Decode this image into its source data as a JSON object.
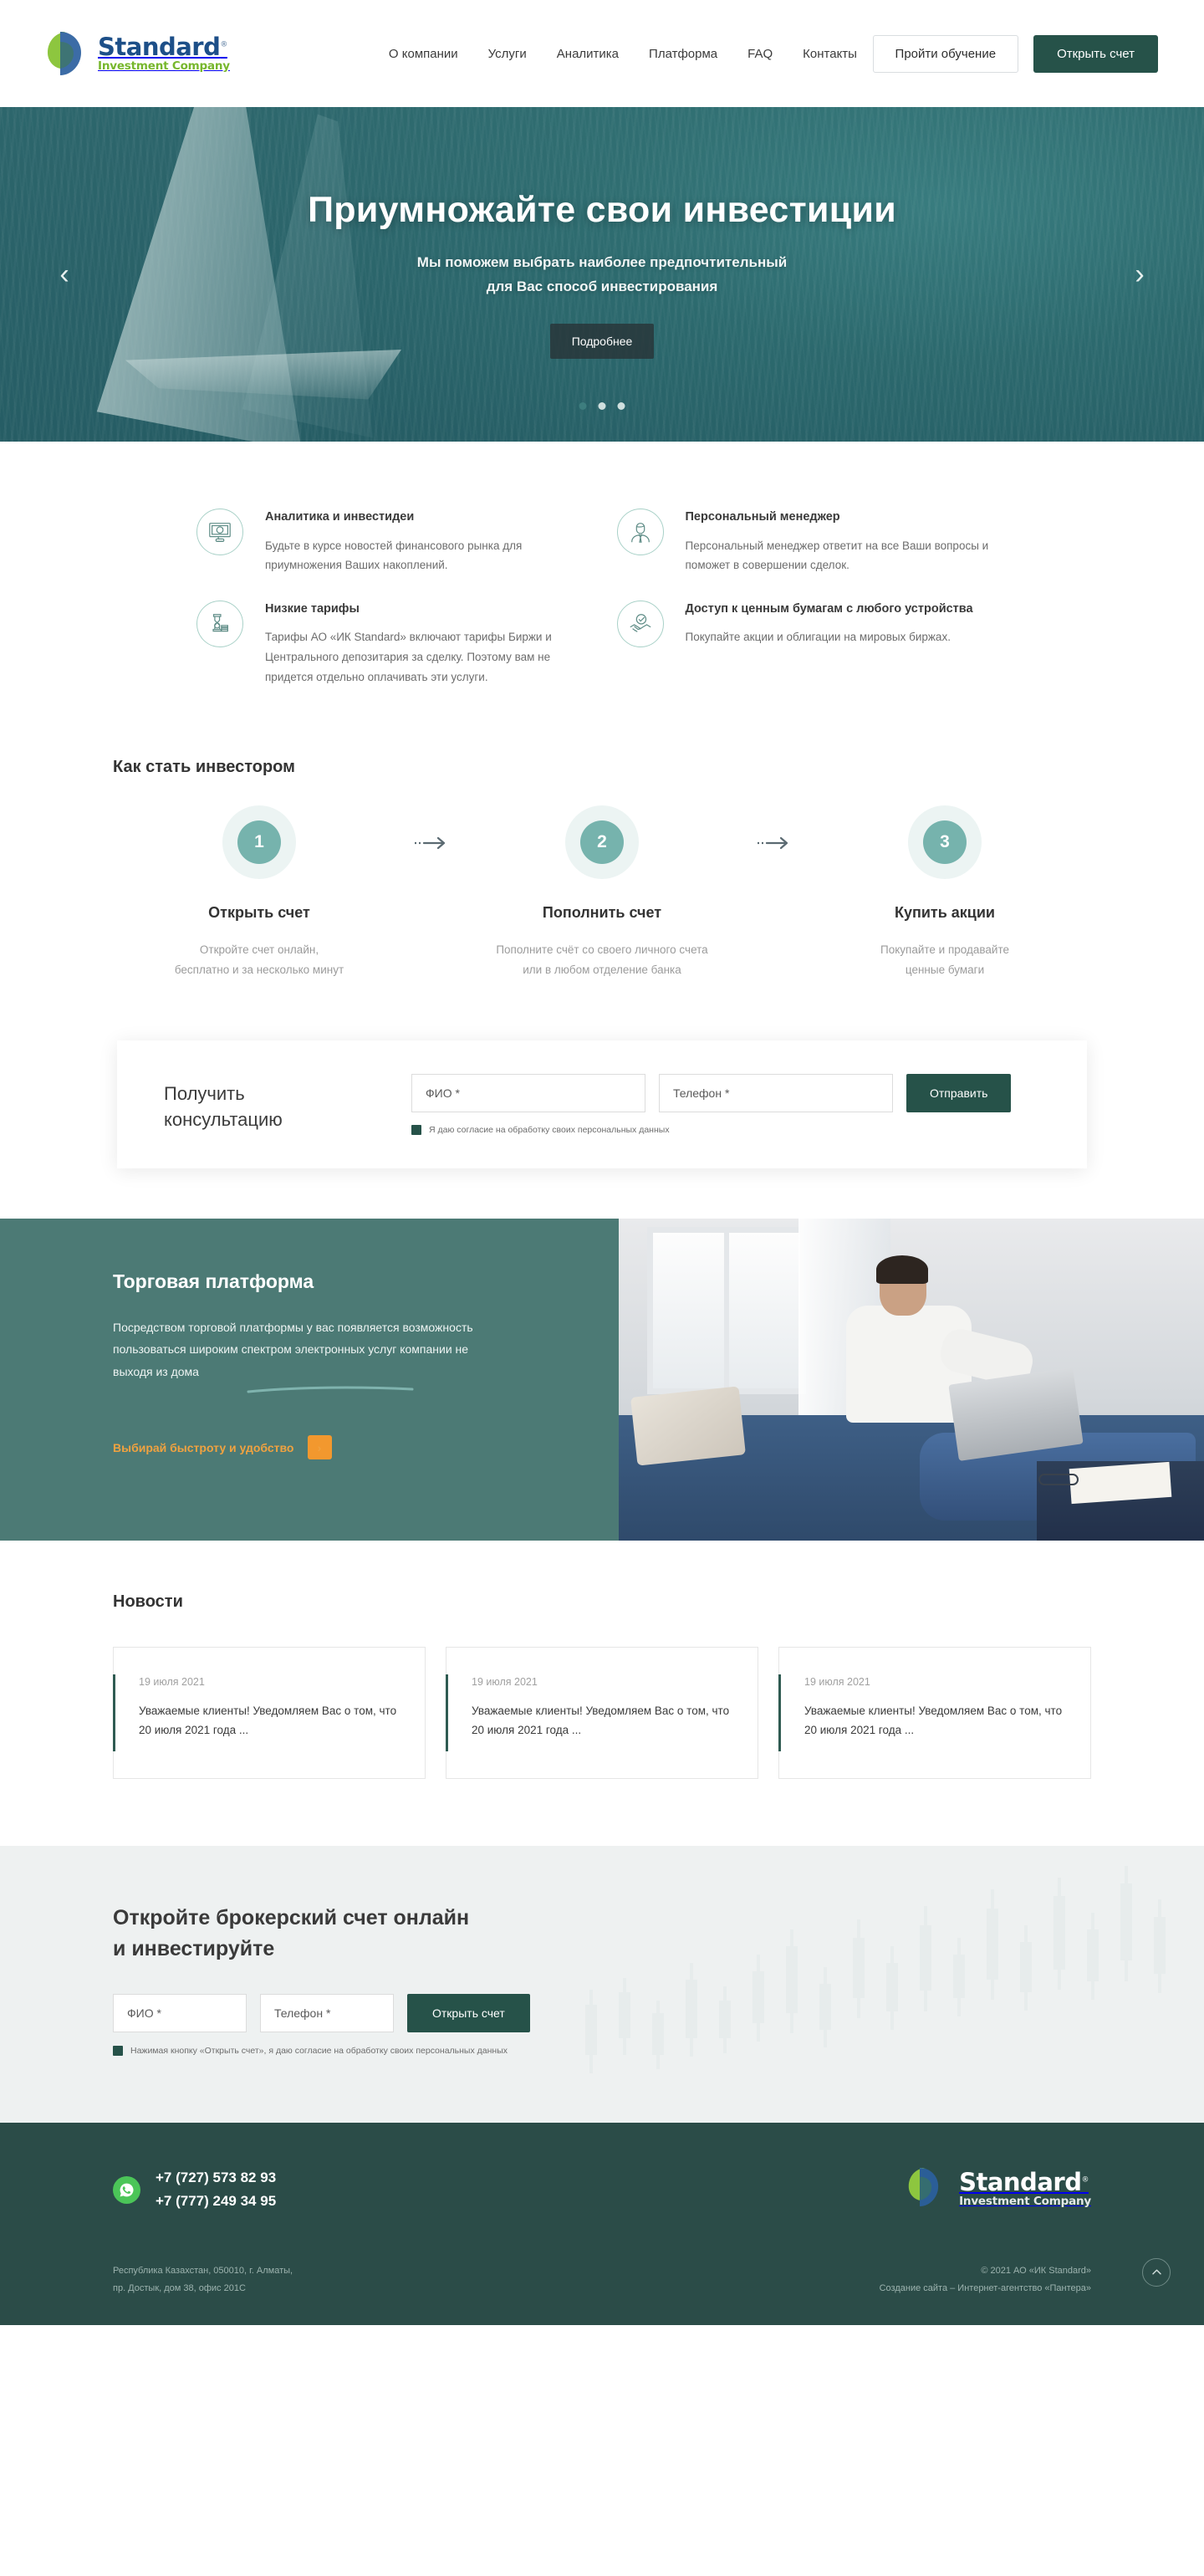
{
  "brand": {
    "name": "Standard",
    "reg": "®",
    "tagline": "Investment Company"
  },
  "header": {
    "nav": [
      {
        "label": "О компании"
      },
      {
        "label": "Услуги"
      },
      {
        "label": "Аналитика"
      },
      {
        "label": "Платформа"
      },
      {
        "label": "FAQ"
      },
      {
        "label": "Контакты"
      }
    ],
    "btn_training": "Пройти обучение",
    "btn_open_account": "Открыть счет"
  },
  "hero": {
    "title": "Приумножайте свои инвестиции",
    "subtitle_line1": "Мы поможем выбрать наиболее предпочтительный",
    "subtitle_line2": "для Вас способ инвестирования",
    "button": "Подробнее",
    "dots": 3,
    "active_dot": 0,
    "prev_icon": "chevron-left-icon",
    "next_icon": "chevron-right-icon"
  },
  "features": [
    {
      "icon": "monitor-analytics-icon",
      "title": "Аналитика и инвестидеи",
      "text": "Будьте в курсе новостей финансового рынка для приумножения Ваших накоплений."
    },
    {
      "icon": "personal-manager-icon",
      "title": "Персональный менеджер",
      "text": "Персональный менеджер ответит на все Ваши вопросы и поможет в совершении сделок."
    },
    {
      "icon": "low-tariffs-icon",
      "title": "Низкие тарифы",
      "text": "Тарифы АО «ИК Standard» включают тарифы Биржи и Центрального депозитария за сделку. Поэтому вам не придется отдельно оплачивать эти услуги."
    },
    {
      "icon": "handshake-access-icon",
      "title": "Доступ к ценным бумагам с любого устройства",
      "text": "Покупайте акции и облигации на мировых биржах."
    }
  ],
  "steps_section": {
    "title": "Как стать инвестором",
    "steps": [
      {
        "number": "1",
        "title": "Открыть счет",
        "desc_line1": "Откройте счет онлайн,",
        "desc_line2": "бесплатно и за несколько минут"
      },
      {
        "number": "2",
        "title": "Пополнить счет",
        "desc_line1": "Пополните счёт со своего личного счета",
        "desc_line2": "или в любом отделение банка"
      },
      {
        "number": "3",
        "title": "Купить акции",
        "desc_line1": "Покупайте и продавайте",
        "desc_line2": "ценные бумаги"
      }
    ]
  },
  "consult": {
    "title_line1": "Получить",
    "title_line2": "консультацию",
    "fio_placeholder": "ФИО *",
    "phone_placeholder": "Телефон *",
    "submit": "Отправить",
    "consent": "Я даю согласие на обработку своих персональных данных",
    "consent_checked": true
  },
  "platform": {
    "title": "Торговая платформа",
    "text": "Посредством торговой платформы у вас появляется возможность пользоваться широким спектром электронных услуг компании не выходя из дома",
    "cta_label": "Выбирай быстроту и удобство",
    "cta_icon": "chevron-right-icon"
  },
  "news_section": {
    "title": "Новости",
    "items": [
      {
        "date": "19 июля 2021",
        "text": "Уважаемые клиенты! Уведомляем Вас о том, что 20 июля 2021 года ..."
      },
      {
        "date": "19 июля 2021",
        "text": "Уважаемые клиенты! Уведомляем Вас о том, что 20 июля 2021 года ..."
      },
      {
        "date": "19 июля 2021",
        "text": "Уважаемые клиенты! Уведомляем Вас о том, что 20 июля 2021 года ..."
      }
    ]
  },
  "open_account": {
    "title_line1": "Откройте брокерский счет онлайн",
    "title_line2": "и инвестируйте",
    "fio_placeholder": "ФИО *",
    "phone_placeholder": "Телефон *",
    "submit": "Открыть счет",
    "consent": "Нажимая кнопку «Открыть счет», я даю согласие на обработку своих персональных данных",
    "consent_checked": true
  },
  "footer": {
    "whatsapp_icon": "whatsapp-icon",
    "phone1": "+7 (727) 573 82 93",
    "phone2": "+7 (777) 249 34 95",
    "address_line1": "Республика Казахстан, 050010, г. Алматы,",
    "address_line2": "пр. Достык, дом 38, офис 201С",
    "copyright": "© 2021 АО «ИК Standard»",
    "credits": "Создание сайта – Интернет-агентство «Пантера»",
    "to_top_icon": "chevron-up-icon"
  },
  "colors": {
    "brand_dark_green": "#265249",
    "brand_teal": "#4c7a75",
    "footer_green": "#2b4c48",
    "accent_orange": "#f2982e",
    "step_teal": "#76b3ad",
    "logo_blue": "#1d4f88",
    "logo_green": "#77b72d",
    "whatsapp_green": "#4bc558"
  }
}
